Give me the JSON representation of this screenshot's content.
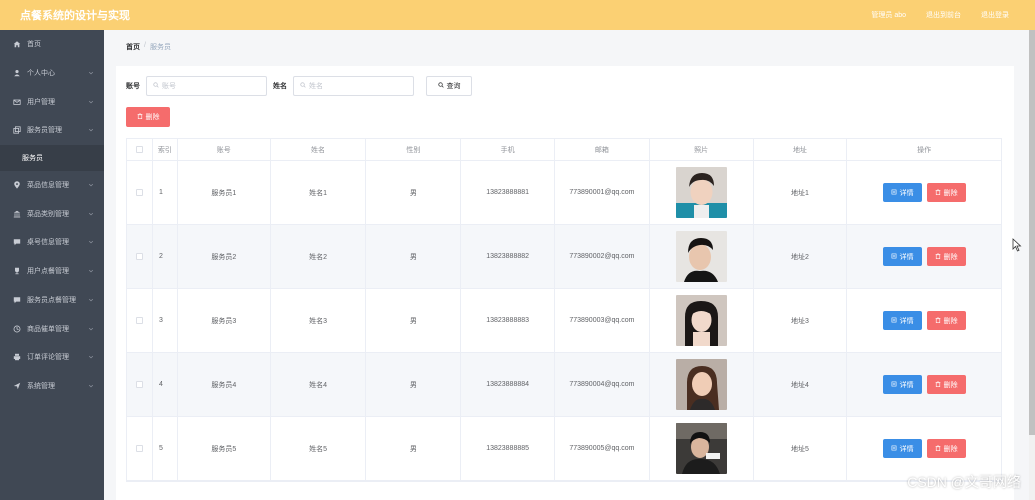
{
  "app": {
    "title": "点餐系统的设计与实现"
  },
  "topbar": {
    "links": [
      "管理员 abo",
      "退出到前台",
      "退出登录"
    ]
  },
  "sidebar": {
    "items": [
      {
        "label": "首页",
        "icon": "home-icon",
        "chevron": false
      },
      {
        "label": "个人中心",
        "icon": "user-icon",
        "chevron": true
      },
      {
        "label": "用户管理",
        "icon": "mail-icon",
        "chevron": true
      },
      {
        "label": "服务员管理",
        "icon": "copy-icon",
        "chevron": true
      },
      {
        "label": "服务员",
        "sub": true
      },
      {
        "label": "菜品信息管理",
        "icon": "location-icon",
        "chevron": true
      },
      {
        "label": "菜品类别管理",
        "icon": "bank-icon",
        "chevron": true
      },
      {
        "label": "桌号信息管理",
        "icon": "message-icon",
        "chevron": true
      },
      {
        "label": "用户点餐管理",
        "icon": "trophy-icon",
        "chevron": true
      },
      {
        "label": "服务员点餐管理",
        "icon": "message-icon",
        "chevron": true
      },
      {
        "label": "商品催单管理",
        "icon": "clock-icon",
        "chevron": true
      },
      {
        "label": "订单评论管理",
        "icon": "printer-icon",
        "chevron": true
      },
      {
        "label": "系统管理",
        "icon": "send-icon",
        "chevron": true
      }
    ]
  },
  "breadcrumb": {
    "home": "首页",
    "sep": "/",
    "current": "服务员"
  },
  "search": {
    "account_label": "账号",
    "account_placeholder": "账号",
    "name_label": "姓名",
    "name_placeholder": "姓名",
    "query_label": "查询"
  },
  "toolbar": {
    "delete_label": "删除"
  },
  "table": {
    "headers": [
      "",
      "索引",
      "账号",
      "姓名",
      "性别",
      "手机",
      "邮箱",
      "照片",
      "地址",
      "操作"
    ],
    "detail_label": "详情",
    "delete_label": "删除",
    "rows": [
      {
        "idx": "1",
        "account": "服务员1",
        "name": "姓名1",
        "sex": "男",
        "phone": "13823888881",
        "email": "773890001@qq.com",
        "address": "地址1"
      },
      {
        "idx": "2",
        "account": "服务员2",
        "name": "姓名2",
        "sex": "男",
        "phone": "13823888882",
        "email": "773890002@qq.com",
        "address": "地址2"
      },
      {
        "idx": "3",
        "account": "服务员3",
        "name": "姓名3",
        "sex": "男",
        "phone": "13823888883",
        "email": "773890003@qq.com",
        "address": "地址3"
      },
      {
        "idx": "4",
        "account": "服务员4",
        "name": "姓名4",
        "sex": "男",
        "phone": "13823888884",
        "email": "773890004@qq.com",
        "address": "地址4"
      },
      {
        "idx": "5",
        "account": "服务员5",
        "name": "姓名5",
        "sex": "男",
        "phone": "13823888885",
        "email": "773890005@qq.com",
        "address": "地址5"
      }
    ]
  },
  "watermark": "CSDN @文哥网络",
  "colors": {
    "topbar": "#fbd073",
    "sidebar": "#404854",
    "primary": "#3a8ee6",
    "danger": "#f56c6c"
  }
}
